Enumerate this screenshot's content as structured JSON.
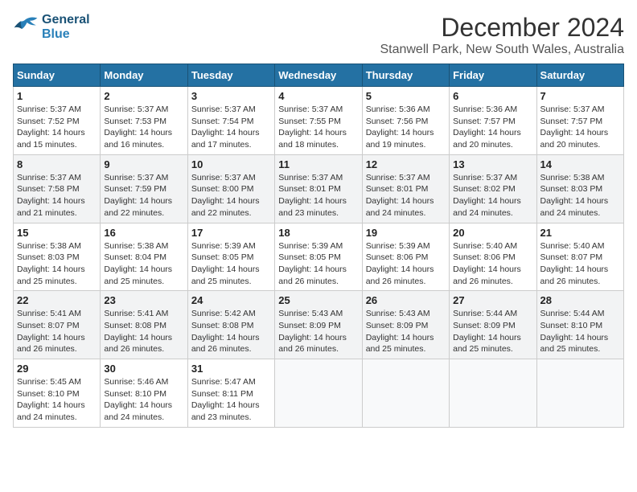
{
  "header": {
    "logo_line1": "General",
    "logo_line2": "Blue",
    "title": "December 2024",
    "subtitle": "Stanwell Park, New South Wales, Australia"
  },
  "weekdays": [
    "Sunday",
    "Monday",
    "Tuesday",
    "Wednesday",
    "Thursday",
    "Friday",
    "Saturday"
  ],
  "weeks": [
    [
      {
        "day": 1,
        "sunrise": "5:37 AM",
        "sunset": "7:52 PM",
        "daylight": "14 hours and 15 minutes."
      },
      {
        "day": 2,
        "sunrise": "5:37 AM",
        "sunset": "7:53 PM",
        "daylight": "14 hours and 16 minutes."
      },
      {
        "day": 3,
        "sunrise": "5:37 AM",
        "sunset": "7:54 PM",
        "daylight": "14 hours and 17 minutes."
      },
      {
        "day": 4,
        "sunrise": "5:37 AM",
        "sunset": "7:55 PM",
        "daylight": "14 hours and 18 minutes."
      },
      {
        "day": 5,
        "sunrise": "5:36 AM",
        "sunset": "7:56 PM",
        "daylight": "14 hours and 19 minutes."
      },
      {
        "day": 6,
        "sunrise": "5:36 AM",
        "sunset": "7:57 PM",
        "daylight": "14 hours and 20 minutes."
      },
      {
        "day": 7,
        "sunrise": "5:37 AM",
        "sunset": "7:57 PM",
        "daylight": "14 hours and 20 minutes."
      }
    ],
    [
      {
        "day": 8,
        "sunrise": "5:37 AM",
        "sunset": "7:58 PM",
        "daylight": "14 hours and 21 minutes."
      },
      {
        "day": 9,
        "sunrise": "5:37 AM",
        "sunset": "7:59 PM",
        "daylight": "14 hours and 22 minutes."
      },
      {
        "day": 10,
        "sunrise": "5:37 AM",
        "sunset": "8:00 PM",
        "daylight": "14 hours and 22 minutes."
      },
      {
        "day": 11,
        "sunrise": "5:37 AM",
        "sunset": "8:01 PM",
        "daylight": "14 hours and 23 minutes."
      },
      {
        "day": 12,
        "sunrise": "5:37 AM",
        "sunset": "8:01 PM",
        "daylight": "14 hours and 24 minutes."
      },
      {
        "day": 13,
        "sunrise": "5:37 AM",
        "sunset": "8:02 PM",
        "daylight": "14 hours and 24 minutes."
      },
      {
        "day": 14,
        "sunrise": "5:38 AM",
        "sunset": "8:03 PM",
        "daylight": "14 hours and 24 minutes."
      }
    ],
    [
      {
        "day": 15,
        "sunrise": "5:38 AM",
        "sunset": "8:03 PM",
        "daylight": "14 hours and 25 minutes."
      },
      {
        "day": 16,
        "sunrise": "5:38 AM",
        "sunset": "8:04 PM",
        "daylight": "14 hours and 25 minutes."
      },
      {
        "day": 17,
        "sunrise": "5:39 AM",
        "sunset": "8:05 PM",
        "daylight": "14 hours and 25 minutes."
      },
      {
        "day": 18,
        "sunrise": "5:39 AM",
        "sunset": "8:05 PM",
        "daylight": "14 hours and 26 minutes."
      },
      {
        "day": 19,
        "sunrise": "5:39 AM",
        "sunset": "8:06 PM",
        "daylight": "14 hours and 26 minutes."
      },
      {
        "day": 20,
        "sunrise": "5:40 AM",
        "sunset": "8:06 PM",
        "daylight": "14 hours and 26 minutes."
      },
      {
        "day": 21,
        "sunrise": "5:40 AM",
        "sunset": "8:07 PM",
        "daylight": "14 hours and 26 minutes."
      }
    ],
    [
      {
        "day": 22,
        "sunrise": "5:41 AM",
        "sunset": "8:07 PM",
        "daylight": "14 hours and 26 minutes."
      },
      {
        "day": 23,
        "sunrise": "5:41 AM",
        "sunset": "8:08 PM",
        "daylight": "14 hours and 26 minutes."
      },
      {
        "day": 24,
        "sunrise": "5:42 AM",
        "sunset": "8:08 PM",
        "daylight": "14 hours and 26 minutes."
      },
      {
        "day": 25,
        "sunrise": "5:43 AM",
        "sunset": "8:09 PM",
        "daylight": "14 hours and 26 minutes."
      },
      {
        "day": 26,
        "sunrise": "5:43 AM",
        "sunset": "8:09 PM",
        "daylight": "14 hours and 25 minutes."
      },
      {
        "day": 27,
        "sunrise": "5:44 AM",
        "sunset": "8:09 PM",
        "daylight": "14 hours and 25 minutes."
      },
      {
        "day": 28,
        "sunrise": "5:44 AM",
        "sunset": "8:10 PM",
        "daylight": "14 hours and 25 minutes."
      }
    ],
    [
      {
        "day": 29,
        "sunrise": "5:45 AM",
        "sunset": "8:10 PM",
        "daylight": "14 hours and 24 minutes."
      },
      {
        "day": 30,
        "sunrise": "5:46 AM",
        "sunset": "8:10 PM",
        "daylight": "14 hours and 24 minutes."
      },
      {
        "day": 31,
        "sunrise": "5:47 AM",
        "sunset": "8:11 PM",
        "daylight": "14 hours and 23 minutes."
      },
      null,
      null,
      null,
      null
    ]
  ],
  "labels": {
    "sunrise": "Sunrise: ",
    "sunset": "Sunset: ",
    "daylight": "Daylight: "
  }
}
